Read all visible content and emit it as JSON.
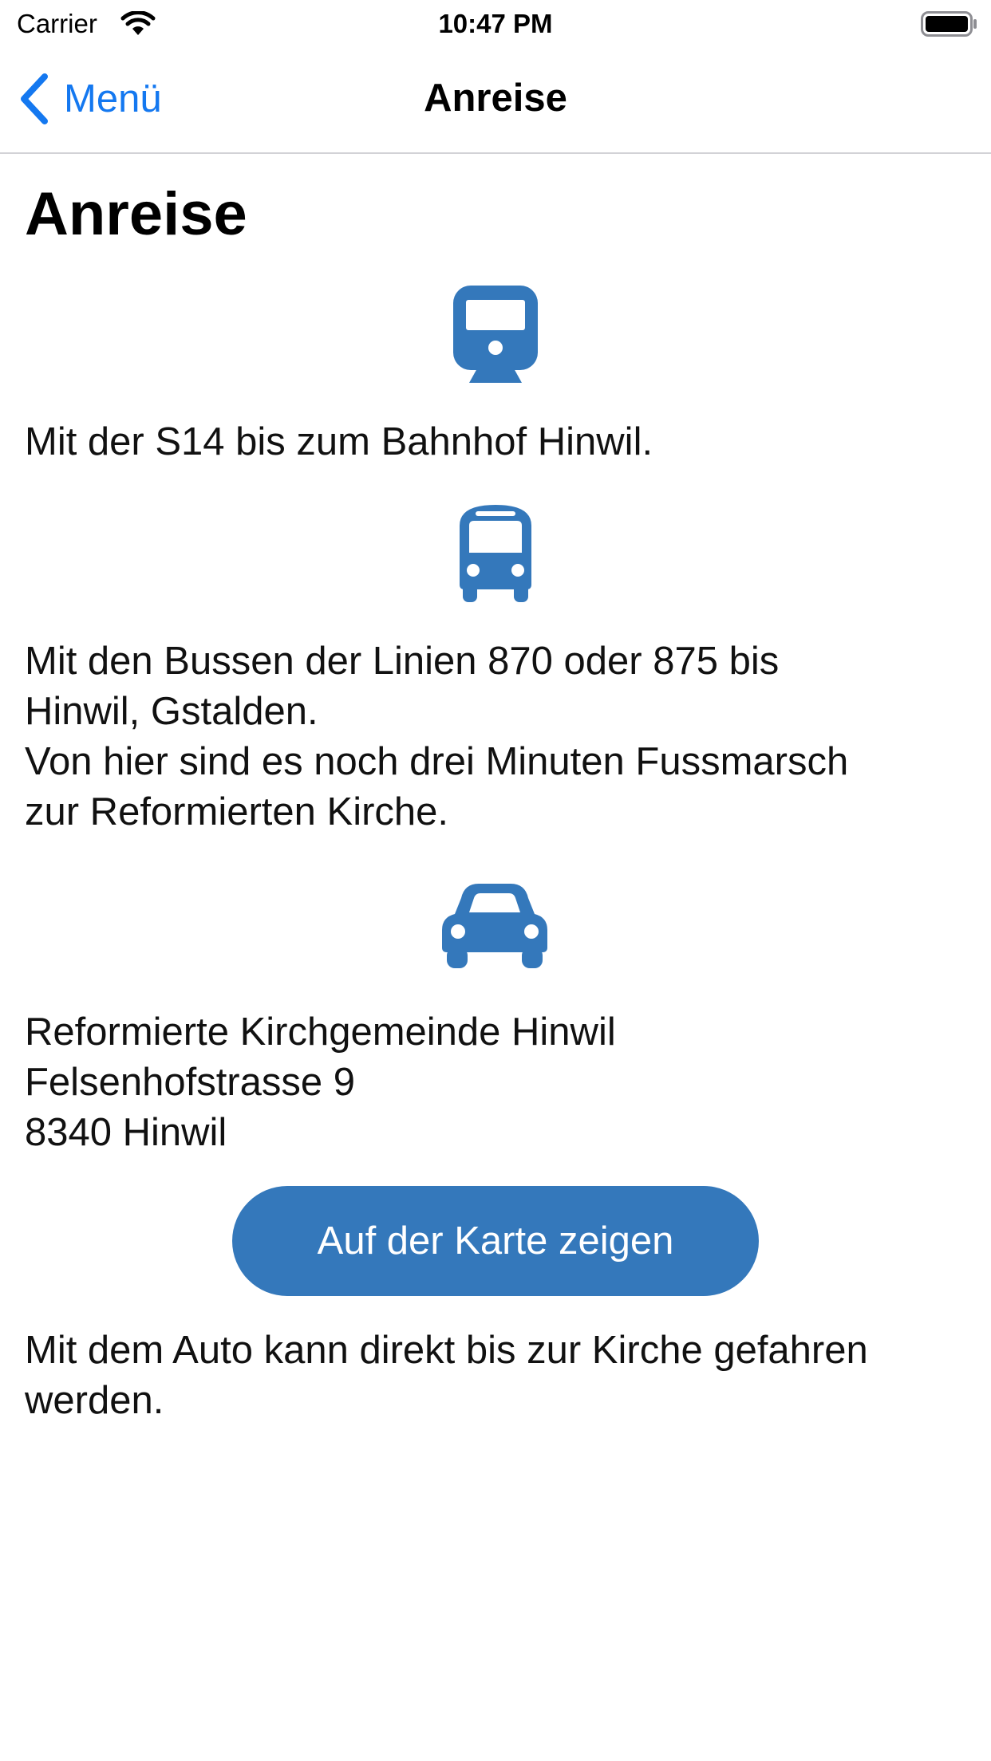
{
  "status_bar": {
    "carrier": "Carrier",
    "time": "10:47 PM"
  },
  "nav": {
    "back_label": "Menü",
    "title": "Anreise"
  },
  "page_title": "Anreise",
  "train": {
    "icon": "train-icon",
    "lines": [
      "Mit der S14 bis zum Bahnhof Hinwil."
    ]
  },
  "bus": {
    "icon": "bus-icon",
    "lines": [
      "Mit den Bussen der Linien 870 oder 875 bis",
      "Hinwil, Gstalden.",
      "Von hier sind es noch drei Minuten Fussmarsch",
      "zur Reformierten Kirche."
    ]
  },
  "car": {
    "icon": "car-icon",
    "address_lines": [
      "Reformierte Kirchgemeinde Hinwil",
      "Felsenhofstrasse 9",
      "8340 Hinwil"
    ],
    "map_button_label": "Auf der Karte zeigen",
    "lines": [
      "Mit dem Auto kann direkt bis zur Kirche gefahren",
      "werden."
    ]
  },
  "colors": {
    "accent": "#1478f0",
    "icon_blue": "#3478bb",
    "button_bg": "#3478bb"
  }
}
